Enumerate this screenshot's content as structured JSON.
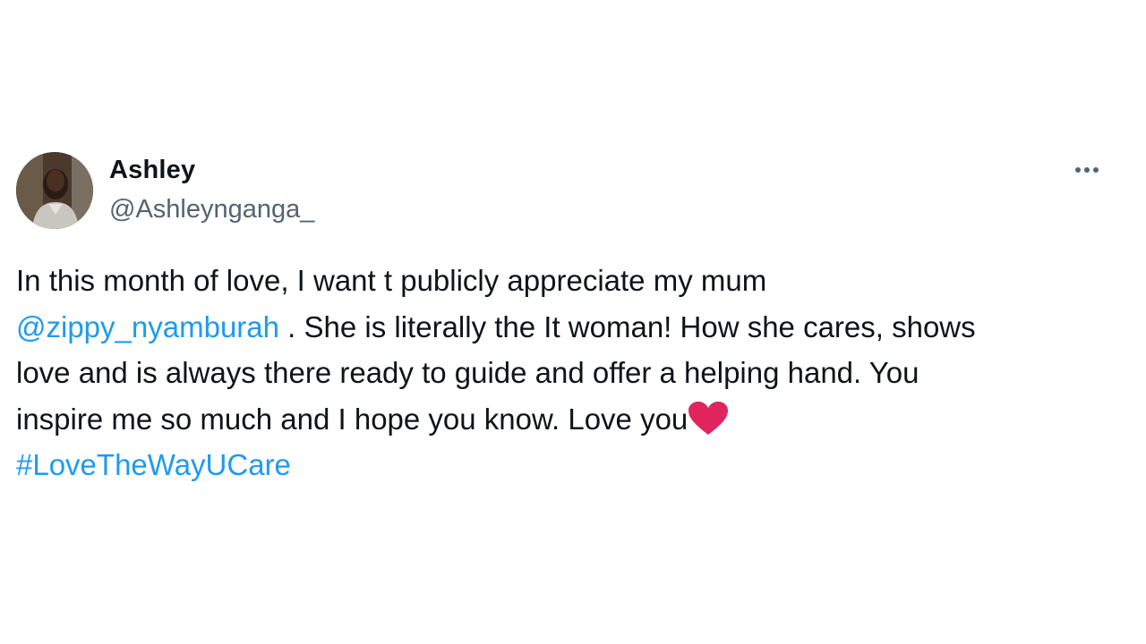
{
  "tweet": {
    "author": {
      "name": "Ashley",
      "handle": "@Ashleynganga_"
    },
    "more_icon": "more-horizontal-icon",
    "text": {
      "line1": "In this month of love, I want t publicly appreciate my mum",
      "mention": "@zippy_nyamburah",
      "line2_rest": " . She is literally the It woman! How she cares, shows",
      "line3": "love and is always there ready to guide and offer a helping hand. You",
      "line4": "inspire me so much and I hope you know. Love you",
      "emoji": "red-heart-icon",
      "hashtag": "#LoveTheWayUCare"
    },
    "colors": {
      "link": "#1d9bf0",
      "text": "#0f1419",
      "secondary": "#536471",
      "heart": "#e0245e"
    }
  }
}
